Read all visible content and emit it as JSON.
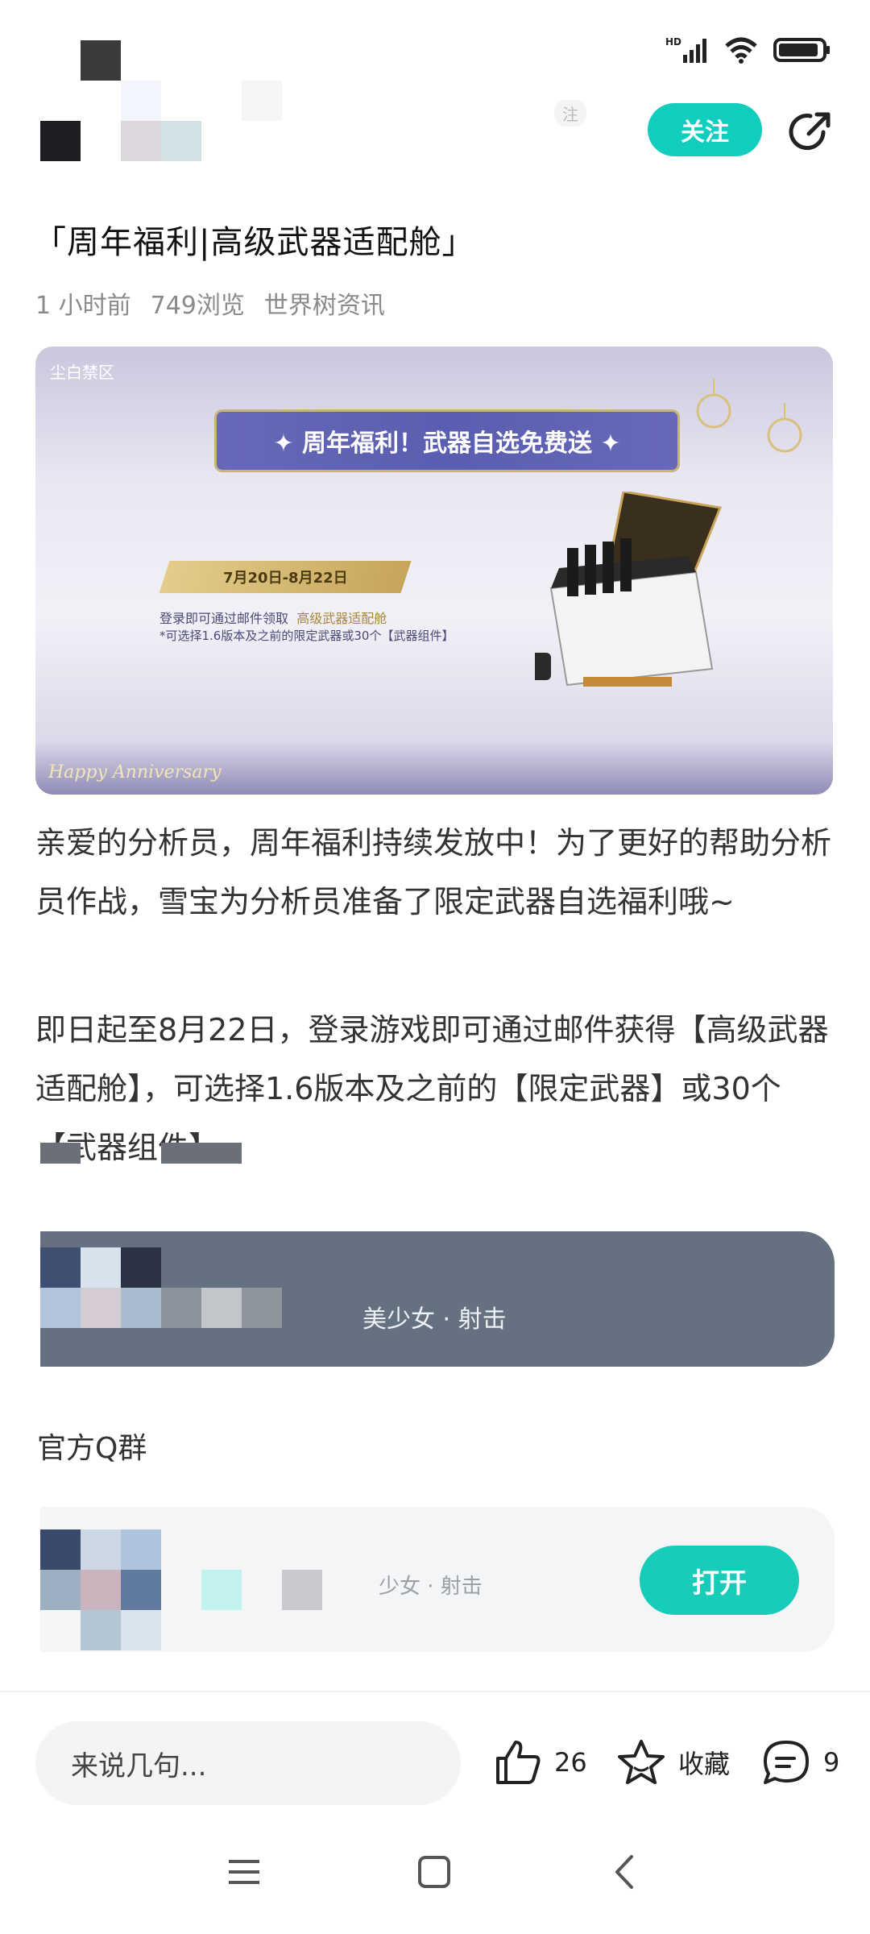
{
  "header": {
    "follow_label": "关注",
    "ghost_badge": "注"
  },
  "article": {
    "title": "「周年福利|高级武器适配舱」",
    "time_ago": "1 小时前",
    "views": "749浏览",
    "category": "世界树资讯",
    "banner": {
      "brand": "尘白禁区",
      "headline": "✦ 周年福利！武器自选免费送 ✦",
      "date_range": "7月20日-8月22日",
      "line1_prefix": "登录即可通过邮件领取",
      "line1_item": "高级武器适配舱",
      "line2": "*可选择1.6版本及之前的限定武器或30个【武器组件】",
      "signature": "Happy Anniversary"
    },
    "paragraph1": "亲爱的分析员，周年福利持续发放中！为了更好的帮助分析员作战，雪宝为分析员准备了限定武器自选福利哦~",
    "paragraph2": "即日起至8月22日，登录游戏即可通过邮件获得【高级武器适配舱】，可选择1.6版本及之前的【限定武器】或30个【武器组件】。"
  },
  "game_card": {
    "subtitle": "美少女 · 射击"
  },
  "qq_section": {
    "label": "官方Q群",
    "subtitle": "少女 · 射击",
    "open_label": "打开"
  },
  "bottom_bar": {
    "comment_placeholder": "来说几句...",
    "likes": "26",
    "favorite_label": "收藏",
    "comments": "9"
  },
  "colors": {
    "accent": "#11cdbd",
    "card_dark": "#657180"
  }
}
